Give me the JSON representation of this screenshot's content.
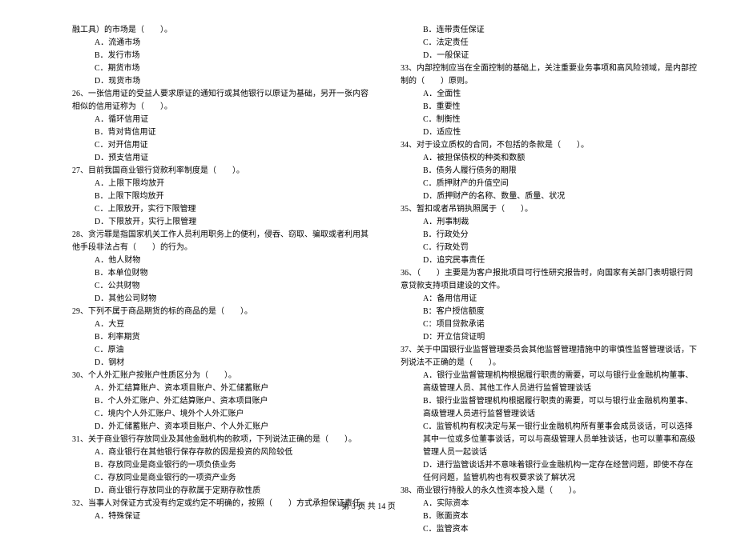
{
  "left": {
    "q25_tail": "融工具）的市场是（　　）。",
    "q25_opts": [
      "A．流通市场",
      "B．发行市场",
      "C．期货市场",
      "D．现货市场"
    ],
    "q26": "26、一张信用证的受益人要求原证的通知行或其他银行以原证为基础，另开一张内容相似的信用证称为（　　）。",
    "q26_opts": [
      "A．循环信用证",
      "B．背对背信用证",
      "C．对开信用证",
      "D．预支信用证"
    ],
    "q27": "27、目前我国商业银行贷款利率制度是（　　）。",
    "q27_opts": [
      "A．上限下限均放开",
      "B．上限下限均放开",
      "C．上限放开，实行下限管理",
      "D．下限放开，实行上限管理"
    ],
    "q28": "28、贪污罪是指国家机关工作人员利用职务上的便利，侵吞、窃取、骗取或者利用其他手段非法占有（　　）的行为。",
    "q28_opts": [
      "A．他人财物",
      "B．本单位财物",
      "C．公共财物",
      "D．其他公司财物"
    ],
    "q29": "29、下列不属于商品期货的标的商品的是（　　）。",
    "q29_opts": [
      "A．大豆",
      "B．利率期货",
      "C．原油",
      "D．钢材"
    ],
    "q30": "30、个人外汇账户按账户性质区分为（　　）。",
    "q30_opts": [
      "A．外汇结算账户、资本项目账户、外汇储蓄账户",
      "B．个人外汇账户、外汇结算账户、资本项目账户",
      "C．境内个人外汇账户、境外个人外汇账户",
      "D．外汇储蓄账户、资本项目账户、个人外汇账户"
    ],
    "q31": "31、关于商业银行存放同业及其他金融机构的款项，下列说法正确的是（　　）。",
    "q31_opts": [
      "A．商业银行在其他银行保存存款的因是投资的风险较低",
      "B．存放同业是商业银行的一项负债业务",
      "C．存放同业是商业银行的一项资产业务",
      "D．商业银行存放同业的存款属于定期存款性质"
    ],
    "q32": "32、当事人对保证方式没有约定或约定不明确的，按照（　　）方式承担保证责任。",
    "q32_opts": [
      "A．特殊保证"
    ]
  },
  "right": {
    "q32_opts_cont": [
      "B．连带责任保证",
      "C．法定责任",
      "D．一般保证"
    ],
    "q33": "33、内部控制应当在全面控制的基础上，关注重要业务事项和高风险领域，是内部控制的（　　）原则。",
    "q33_opts": [
      "A．全面性",
      "B．重要性",
      "C．制衡性",
      "D．适应性"
    ],
    "q34": "34、对于设立质权的合同，不包括的条款是（　　）。",
    "q34_opts": [
      "A．被担保债权的种类和数额",
      "B．债务人履行债务的期限",
      "C．质押财产的升值空间",
      "D．质押财产的名称、数量、质量、状况"
    ],
    "q35": "35、暂扣或者吊销执照属于（　　）。",
    "q35_opts": [
      "A．刑事制裁",
      "B．行政处分",
      "C．行政处罚",
      "D．追究民事责任"
    ],
    "q36": "36、（　　）主要是为客户报批项目可行性研究报告时，向国家有关部门表明银行同意贷款支持项目建设的文件。",
    "q36_opts": [
      "A：备用信用证",
      "B：客户授信额度",
      "C：项目贷款承诺",
      "D：开立信贷证明"
    ],
    "q37": "37、关于中国银行业监督管理委员会其他监督管理措施中的审慎性监督管理谈话，下列说法不正确的是（　　）。",
    "q37_opts": [
      "A．银行业监督管理机构根据履行职责的需要，可以与银行业金融机构董事、高级管理人员、其他工作人员进行监督管理谈话",
      "B．银行业监督管理机构根据履行职责的需要，可以与银行业金融机构董事、高级管理人员进行监督管理谈话",
      "C．监管机构有权决定与某一银行业金融机构所有董事会成员谈话，可以选择其中一位或多位董事谈话，可以与高级管理人员单独谈话，也可以董事和高级管理人员一起谈话",
      "D．进行监管谈话并不意味着银行业金融机构一定存在经营问题，即使不存在任何问题，监管机构也有权要求谈了解状况"
    ],
    "q38": "38、商业银行持股人的永久性资本投入是（　　）。",
    "q38_opts": [
      "A．实际资本",
      "B．账面资本",
      "C．监管资本"
    ]
  },
  "footer": "第 3 页 共 14 页"
}
